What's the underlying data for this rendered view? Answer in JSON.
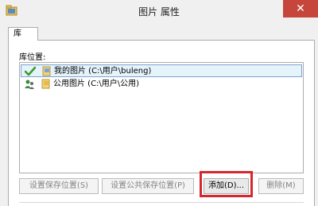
{
  "window": {
    "title": "图片 属性",
    "close_glyph": "✕"
  },
  "tabs": [
    {
      "label": "库",
      "active": true
    }
  ],
  "library": {
    "locations_label": "库位置:",
    "rows": [
      {
        "label": "我的图片 (C:\\用户\\buleng)",
        "selected": true,
        "icon": "check-mark-icon"
      },
      {
        "label": "公用图片 (C:\\用户\\公用)",
        "selected": false,
        "icon": "users-icon"
      }
    ]
  },
  "buttons": {
    "set_save_location": "设置保存位置(S)",
    "set_public_save_location": "设置公共保存位置(P)",
    "add": "添加(D)...",
    "remove": "删除(M)"
  },
  "colors": {
    "accent_highlight": "#d6272e",
    "close_button": "#c7463b",
    "selection_fill": "#e5f3fb",
    "selection_border": "#7da2ce"
  }
}
